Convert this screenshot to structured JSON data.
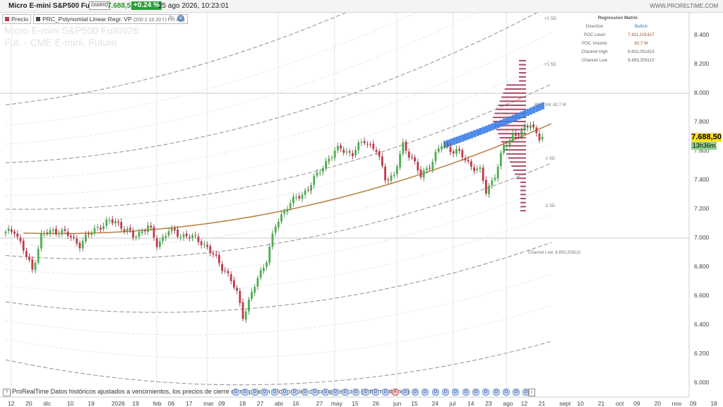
{
  "header": {
    "symbol": "Micro E-mini S&P500 Full0926",
    "timeframe": "DIARIO",
    "price": "7.688,50",
    "change": "+0.24 %",
    "datetime": "25 ago 2026, 10:23:01",
    "brand": "WWW.PRORELTIME.COM"
  },
  "legend": {
    "price_label": "Precio",
    "indicator_label": "PRC_Polynomial Linear Regr. VP",
    "indicator_params": "(200 2 10 20 f t t t t 4 9)",
    "fx": "fx",
    "close": "×"
  },
  "watermark": {
    "line1": "Micro E-mini S&P500 Full0926",
    "line2": "Fut. - CME E-mini, Futuro"
  },
  "regression_matrix": {
    "title": "Regression Matrix",
    "rows": [
      {
        "key": "Direction",
        "value": "Bullish"
      },
      {
        "key": "POC Level",
        "value": "7.811,101427"
      },
      {
        "key": "POC Volume",
        "value": "82,7 M"
      },
      {
        "key": "Channel High",
        "value": "6.832,051615"
      },
      {
        "key": "Channel Low",
        "value": "6.893,209110"
      }
    ]
  },
  "sd_labels": {
    "p2": "+2 SD",
    "p1": "+1 SD",
    "m1": "-1 SD",
    "m2": "-2 SD",
    "poc": "POC Vol: 82,7 M",
    "channel_low": "Channel Low: 6.893,209110"
  },
  "price_box": "7.688,50",
  "time_box": "13h36m",
  "bottom": {
    "icon": "?",
    "text": "ProRealTime Datos históricos ajustados a vencimientos, los precios de cierre corresponden a los precios de compensación (settlement price)",
    "info": "i"
  },
  "colors": {
    "up": "#4caf50",
    "down": "#c0394b",
    "regression": "#b8864a",
    "band": "#aaaaaa",
    "profile": "#9b2d4a",
    "profile_blue": "#3b7ee8",
    "price_box": "#ffe600"
  },
  "chart_data": {
    "type": "candlestick",
    "ylim": [
      5950,
      8600
    ],
    "yticks": [
      "8.400",
      "8.200",
      "8.000",
      "7.800",
      "7.600",
      "7.400",
      "7.200",
      "7.000",
      "6.800",
      "6.600",
      "6.400",
      "6.200",
      "6.000"
    ],
    "ytick_values": [
      8400,
      8200,
      8000,
      7800,
      7600,
      7400,
      7200,
      7000,
      6800,
      6600,
      6400,
      6200,
      6000
    ],
    "xticks": [
      "12",
      "20",
      "dic",
      "10",
      "19",
      "2026",
      "19",
      "feb",
      "06",
      "17",
      "mar",
      "09",
      "18",
      "27",
      "abr",
      "16",
      "27",
      "may",
      "15",
      "26",
      "jun",
      "15",
      "24",
      "jul",
      "14",
      "23",
      "ago",
      "12",
      "21",
      "sept",
      "10",
      "21",
      "oct",
      "09",
      "20",
      "nov",
      "09",
      "18"
    ],
    "xtick_index": [
      0,
      6,
      12,
      20,
      27,
      35,
      42,
      49,
      54,
      60,
      66,
      71,
      78,
      84,
      90,
      96,
      104,
      109,
      116,
      123,
      130,
      136,
      143,
      149,
      155,
      161,
      167,
      173,
      179,
      186,
      192,
      199,
      205,
      211,
      218,
      224,
      230,
      237
    ],
    "last_price": 7688.5,
    "poc_volume": "82,7 M",
    "anchors": [
      [
        0,
        7030
      ],
      [
        3,
        7060
      ],
      [
        7,
        6870
      ],
      [
        9,
        6780
      ],
      [
        12,
        7020
      ],
      [
        18,
        7060
      ],
      [
        25,
        6960
      ],
      [
        31,
        7080
      ],
      [
        37,
        7120
      ],
      [
        43,
        7010
      ],
      [
        48,
        7080
      ],
      [
        51,
        6960
      ],
      [
        55,
        7050
      ],
      [
        60,
        7020
      ],
      [
        66,
        6980
      ],
      [
        70,
        6880
      ],
      [
        74,
        6780
      ],
      [
        78,
        6620
      ],
      [
        80,
        6470
      ],
      [
        82,
        6560
      ],
      [
        85,
        6720
      ],
      [
        88,
        6860
      ],
      [
        91,
        7080
      ],
      [
        95,
        7230
      ],
      [
        100,
        7300
      ],
      [
        105,
        7430
      ],
      [
        109,
        7560
      ],
      [
        113,
        7620
      ],
      [
        117,
        7580
      ],
      [
        121,
        7680
      ],
      [
        125,
        7600
      ],
      [
        128,
        7420
      ],
      [
        131,
        7430
      ],
      [
        134,
        7640
      ],
      [
        137,
        7560
      ],
      [
        140,
        7420
      ],
      [
        143,
        7510
      ],
      [
        147,
        7640
      ],
      [
        152,
        7600
      ],
      [
        156,
        7520
      ],
      [
        160,
        7460
      ],
      [
        162,
        7320
      ],
      [
        165,
        7440
      ],
      [
        168,
        7620
      ],
      [
        171,
        7720
      ],
      [
        174,
        7720
      ],
      [
        177,
        7800
      ],
      [
        180,
        7690
      ]
    ]
  }
}
